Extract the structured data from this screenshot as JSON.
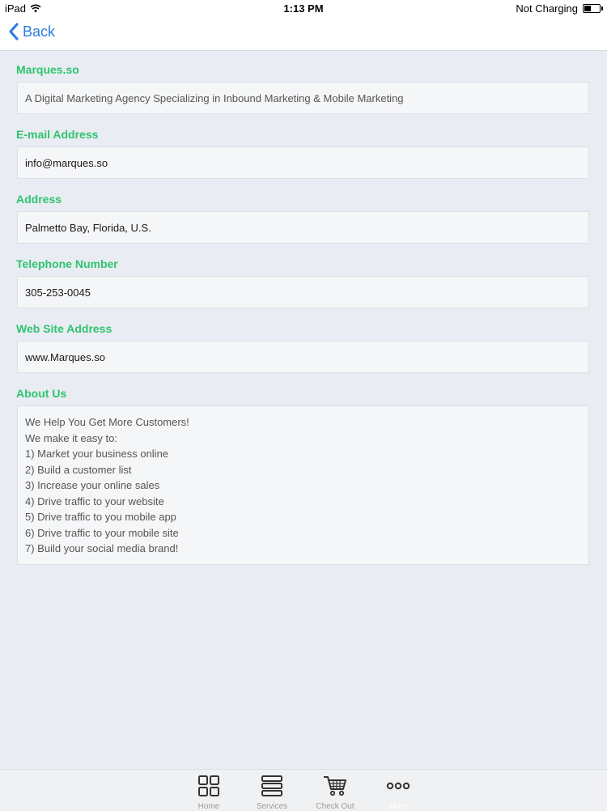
{
  "status": {
    "device": "iPad",
    "time": "1:13 PM",
    "battery_text": "Not Charging",
    "battery_level": 0.45
  },
  "nav": {
    "back_label": "Back"
  },
  "fields": [
    {
      "label": "Marques.so",
      "value": "A Digital Marketing Agency Specializing in Inbound Marketing & Mobile Marketing"
    },
    {
      "label": "E-mail Address",
      "value": "info@marques.so"
    },
    {
      "label": "Address",
      "value": "Palmetto Bay, Florida, U.S."
    },
    {
      "label": "Telephone Number",
      "value": "305-253-0045"
    },
    {
      "label": "Web Site Address",
      "value": "www.Marques.so"
    }
  ],
  "about": {
    "label": "About Us",
    "lines": [
      "We Help You Get More Customers!",
      "We make it easy to:",
      "1) Market your business online",
      "2) Build a customer list",
      "3) Increase your online sales",
      "4) Drive traffic to your website",
      "5) Drive traffic to you mobile app",
      "6) Drive traffic to your mobile site",
      "7) Build your social media brand!"
    ]
  },
  "tabs": [
    {
      "label": "Home",
      "icon": "grid-icon"
    },
    {
      "label": "Services",
      "icon": "stack-icon"
    },
    {
      "label": "Check Out",
      "icon": "cart-icon"
    },
    {
      "label": "More",
      "icon": "more-icon"
    }
  ],
  "colors": {
    "accent": "#2a7bde",
    "label_green": "#2ec470",
    "background": "#e9ecf2"
  }
}
